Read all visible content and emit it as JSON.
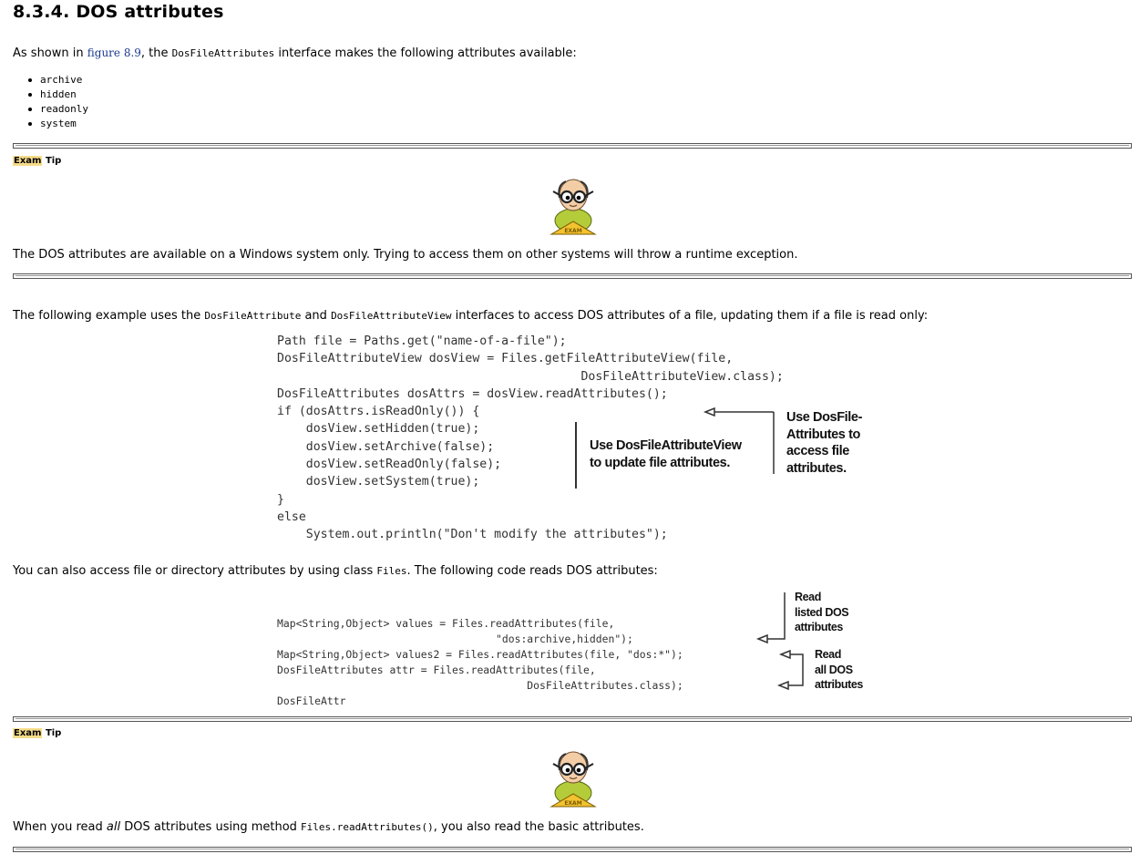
{
  "heading": "8.3.4. DOS attributes",
  "intro": {
    "before": "As shown in ",
    "figure_link": "figure 8.9",
    "middle": ", the ",
    "interface": "DosFileAttributes",
    "after": " interface makes the following attributes available:"
  },
  "attributes": [
    "archive",
    "hidden",
    "readonly",
    "system"
  ],
  "tips": [
    {
      "exam": "Exam",
      "tip": "Tip",
      "text": "The DOS attributes are available on a Windows system only. Trying to access them on other systems will throw a runtime exception."
    },
    {
      "exam": "Exam",
      "tip": "Tip",
      "before": "When you read ",
      "emphasis": "all",
      "middle": " DOS attributes using method ",
      "code": "Files.readAttributes()",
      "after": ", you also read the basic attributes."
    }
  ],
  "example_para": {
    "before": "The following example uses the ",
    "code1": "DosFileAttribute",
    "and": " and ",
    "code2": "DosFileAttributeView",
    "after": " interfaces to access DOS attributes of a file, updating them if a file is read only:"
  },
  "code_listing_1": [
    "Path file = Paths.get(\"name-of-a-file\");",
    "DosFileAttributeView dosView = Files.getFileAttributeView(file,",
    "                                          DosFileAttributeView.class);",
    "DosFileAttributes dosAttrs = dosView.readAttributes();",
    "if (dosAttrs.isReadOnly()) {",
    "    dosView.setHidden(true);",
    "    dosView.setArchive(false);",
    "    dosView.setReadOnly(false);",
    "    dosView.setSystem(true);",
    "}",
    "else",
    "    System.out.println(\"Don't modify the attributes\");"
  ],
  "annotations_1": {
    "view": [
      "Use DosFileAttributeView",
      "to update file attributes."
    ],
    "attrs": [
      "Use DosFile-",
      "Attributes to",
      "access file",
      "attributes."
    ]
  },
  "files_para": {
    "before": "You can also access file or directory attributes by using class ",
    "code": "Files",
    "after": ". The following code reads DOS attributes:"
  },
  "code_listing_2": [
    "Map<String,Object> values = Files.readAttributes(file,",
    "                                   \"dos:archive,hidden\");",
    "Map<String,Object> values2 = Files.readAttributes(file, \"dos:*\");",
    "DosFileAttributes attr = Files.readAttributes(file,",
    "                                        DosFileAttributes.class);",
    "DosFileAttr"
  ],
  "annotations_2": {
    "listed": [
      "Read",
      "listed DOS",
      "attributes"
    ],
    "all": [
      "Read",
      "all DOS",
      "attributes"
    ]
  },
  "mascot_badge": "EXAM",
  "colors": {
    "exam_highlight": "#f6dc8a",
    "link": "#1a3a8f",
    "mascot_shirt": "#b5cc3a"
  }
}
